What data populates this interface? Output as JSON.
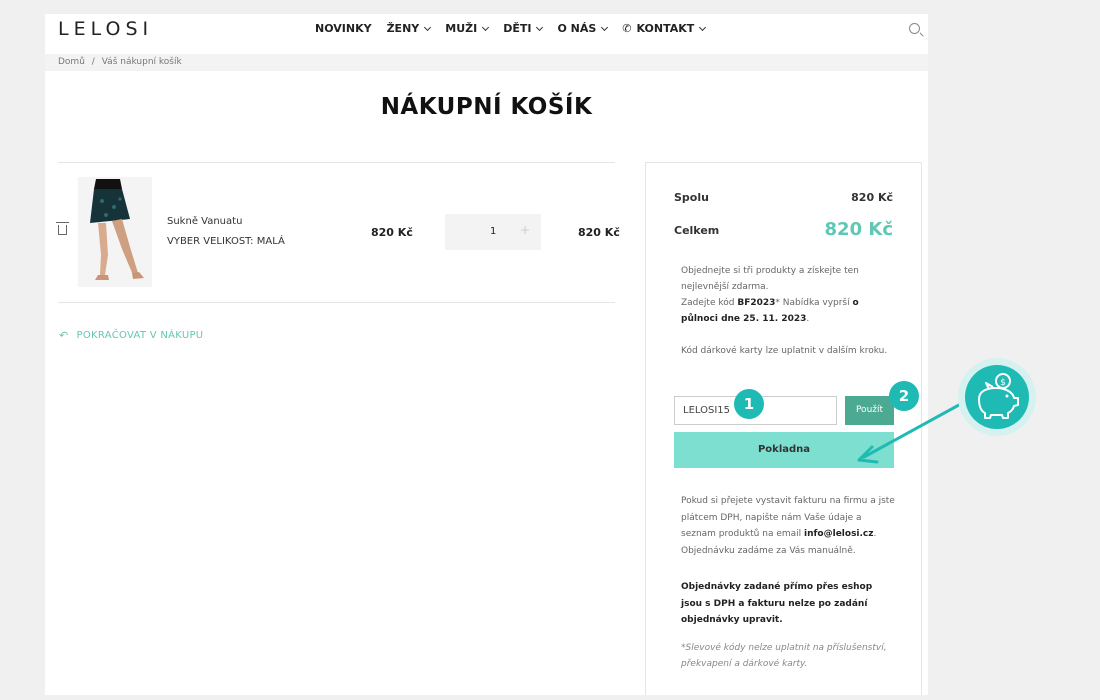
{
  "header": {
    "logo": "LELOSI",
    "nav": [
      "NOVINKY",
      "ŽENY",
      "MUŽI",
      "DĚTI",
      "O NÁS",
      "KONTAKT"
    ]
  },
  "breadcrumb": [
    "Domů",
    "/",
    "Váš nákupní košík"
  ],
  "page_title": "NÁKUPNÍ KOŠÍK",
  "cart": {
    "item_name": "Sukně Vanuatu",
    "item_size": "VYBER VELIKOST: MALÁ",
    "price": "820 Kč",
    "quantity": "1",
    "plus": "+",
    "total": "820 Kč",
    "continue_label": "POKRAČOVAT V NÁKUPU"
  },
  "summary": {
    "subtotal_label": "Spolu",
    "subtotal_value": "820 Kč",
    "total_label": "Celkem",
    "total_value": "820 Kč",
    "promo_line1": "Objednejte si tři produkty a získejte ten nejlevnější zdarma.",
    "promo_line2_pre": "Zadejte kód ",
    "promo_code": "BF2023",
    "promo_line2_post": "* Nabídka vyprší ",
    "promo_deadline": "o půlnoci dne 25. 11. 2023",
    "promo_end": ".",
    "gift_note": "Kód dárkové karty lze uplatnit v dalším kroku.",
    "coupon_value": "LELOSI15",
    "apply_label": "Použít",
    "checkout_label": "Pokladna",
    "invoice_pre": "Pokud si přejete vystavit fakturu na firmu a jste plátcem DPH, napište nám Vaše údaje a seznam produktů na email ",
    "invoice_email": "info@lelosi.cz",
    "invoice_post": ". Objednávku zadáme za Vás manuálně.",
    "vat_note": "Objednávky zadané přímo přes eshop jsou s DPH a fakturu nelze po zadání objednávky upravit.",
    "excluded_note": "*Slevové kódy nelze uplatnit na příslušenství, překvapení a dárkové karty."
  },
  "annotations": {
    "badge1": "1",
    "badge2": "2"
  },
  "colors": {
    "accent": "#5fc8b4",
    "checkout": "#7ddfcf",
    "apply": "#4daa92",
    "annotation": "#1fbab3"
  }
}
